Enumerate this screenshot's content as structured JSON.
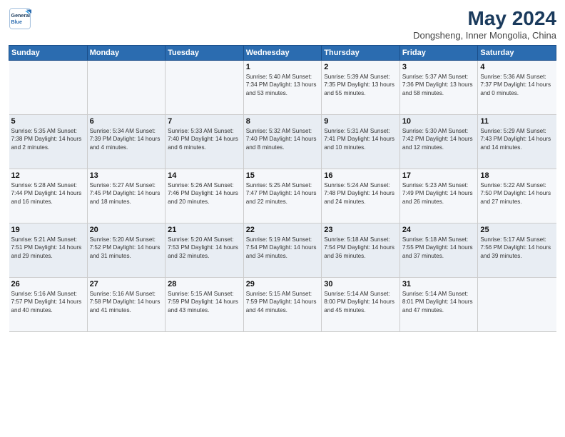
{
  "logo": {
    "line1": "General",
    "line2": "Blue"
  },
  "title": "May 2024",
  "subtitle": "Dongsheng, Inner Mongolia, China",
  "days_of_week": [
    "Sunday",
    "Monday",
    "Tuesday",
    "Wednesday",
    "Thursday",
    "Friday",
    "Saturday"
  ],
  "weeks": [
    [
      {
        "day": "",
        "info": ""
      },
      {
        "day": "",
        "info": ""
      },
      {
        "day": "",
        "info": ""
      },
      {
        "day": "1",
        "info": "Sunrise: 5:40 AM\nSunset: 7:34 PM\nDaylight: 13 hours\nand 53 minutes."
      },
      {
        "day": "2",
        "info": "Sunrise: 5:39 AM\nSunset: 7:35 PM\nDaylight: 13 hours\nand 55 minutes."
      },
      {
        "day": "3",
        "info": "Sunrise: 5:37 AM\nSunset: 7:36 PM\nDaylight: 13 hours\nand 58 minutes."
      },
      {
        "day": "4",
        "info": "Sunrise: 5:36 AM\nSunset: 7:37 PM\nDaylight: 14 hours\nand 0 minutes."
      }
    ],
    [
      {
        "day": "5",
        "info": "Sunrise: 5:35 AM\nSunset: 7:38 PM\nDaylight: 14 hours\nand 2 minutes."
      },
      {
        "day": "6",
        "info": "Sunrise: 5:34 AM\nSunset: 7:39 PM\nDaylight: 14 hours\nand 4 minutes."
      },
      {
        "day": "7",
        "info": "Sunrise: 5:33 AM\nSunset: 7:40 PM\nDaylight: 14 hours\nand 6 minutes."
      },
      {
        "day": "8",
        "info": "Sunrise: 5:32 AM\nSunset: 7:40 PM\nDaylight: 14 hours\nand 8 minutes."
      },
      {
        "day": "9",
        "info": "Sunrise: 5:31 AM\nSunset: 7:41 PM\nDaylight: 14 hours\nand 10 minutes."
      },
      {
        "day": "10",
        "info": "Sunrise: 5:30 AM\nSunset: 7:42 PM\nDaylight: 14 hours\nand 12 minutes."
      },
      {
        "day": "11",
        "info": "Sunrise: 5:29 AM\nSunset: 7:43 PM\nDaylight: 14 hours\nand 14 minutes."
      }
    ],
    [
      {
        "day": "12",
        "info": "Sunrise: 5:28 AM\nSunset: 7:44 PM\nDaylight: 14 hours\nand 16 minutes."
      },
      {
        "day": "13",
        "info": "Sunrise: 5:27 AM\nSunset: 7:45 PM\nDaylight: 14 hours\nand 18 minutes."
      },
      {
        "day": "14",
        "info": "Sunrise: 5:26 AM\nSunset: 7:46 PM\nDaylight: 14 hours\nand 20 minutes."
      },
      {
        "day": "15",
        "info": "Sunrise: 5:25 AM\nSunset: 7:47 PM\nDaylight: 14 hours\nand 22 minutes."
      },
      {
        "day": "16",
        "info": "Sunrise: 5:24 AM\nSunset: 7:48 PM\nDaylight: 14 hours\nand 24 minutes."
      },
      {
        "day": "17",
        "info": "Sunrise: 5:23 AM\nSunset: 7:49 PM\nDaylight: 14 hours\nand 26 minutes."
      },
      {
        "day": "18",
        "info": "Sunrise: 5:22 AM\nSunset: 7:50 PM\nDaylight: 14 hours\nand 27 minutes."
      }
    ],
    [
      {
        "day": "19",
        "info": "Sunrise: 5:21 AM\nSunset: 7:51 PM\nDaylight: 14 hours\nand 29 minutes."
      },
      {
        "day": "20",
        "info": "Sunrise: 5:20 AM\nSunset: 7:52 PM\nDaylight: 14 hours\nand 31 minutes."
      },
      {
        "day": "21",
        "info": "Sunrise: 5:20 AM\nSunset: 7:53 PM\nDaylight: 14 hours\nand 32 minutes."
      },
      {
        "day": "22",
        "info": "Sunrise: 5:19 AM\nSunset: 7:54 PM\nDaylight: 14 hours\nand 34 minutes."
      },
      {
        "day": "23",
        "info": "Sunrise: 5:18 AM\nSunset: 7:54 PM\nDaylight: 14 hours\nand 36 minutes."
      },
      {
        "day": "24",
        "info": "Sunrise: 5:18 AM\nSunset: 7:55 PM\nDaylight: 14 hours\nand 37 minutes."
      },
      {
        "day": "25",
        "info": "Sunrise: 5:17 AM\nSunset: 7:56 PM\nDaylight: 14 hours\nand 39 minutes."
      }
    ],
    [
      {
        "day": "26",
        "info": "Sunrise: 5:16 AM\nSunset: 7:57 PM\nDaylight: 14 hours\nand 40 minutes."
      },
      {
        "day": "27",
        "info": "Sunrise: 5:16 AM\nSunset: 7:58 PM\nDaylight: 14 hours\nand 41 minutes."
      },
      {
        "day": "28",
        "info": "Sunrise: 5:15 AM\nSunset: 7:59 PM\nDaylight: 14 hours\nand 43 minutes."
      },
      {
        "day": "29",
        "info": "Sunrise: 5:15 AM\nSunset: 7:59 PM\nDaylight: 14 hours\nand 44 minutes."
      },
      {
        "day": "30",
        "info": "Sunrise: 5:14 AM\nSunset: 8:00 PM\nDaylight: 14 hours\nand 45 minutes."
      },
      {
        "day": "31",
        "info": "Sunrise: 5:14 AM\nSunset: 8:01 PM\nDaylight: 14 hours\nand 47 minutes."
      },
      {
        "day": "",
        "info": ""
      }
    ]
  ]
}
